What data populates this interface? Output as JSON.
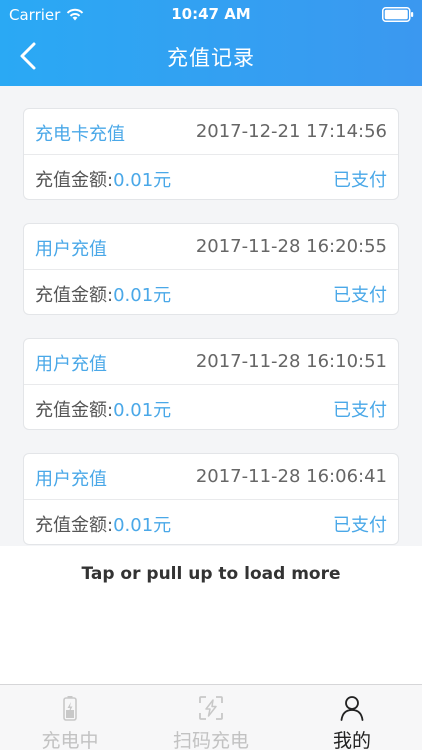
{
  "status_bar": {
    "carrier": "Carrier",
    "time": "10:47 AM"
  },
  "nav": {
    "title": "充值记录",
    "back_icon": "chevron-left-icon"
  },
  "records": [
    {
      "type": "充电卡充值",
      "time": "2017-12-21 17:14:56",
      "amount_label": "充值金额:",
      "amount": "0.01元",
      "status": "已支付"
    },
    {
      "type": "用户充值",
      "time": "2017-11-28 16:20:55",
      "amount_label": "充值金额:",
      "amount": "0.01元",
      "status": "已支付"
    },
    {
      "type": "用户充值",
      "time": "2017-11-28 16:10:51",
      "amount_label": "充值金额:",
      "amount": "0.01元",
      "status": "已支付"
    },
    {
      "type": "用户充值",
      "time": "2017-11-28 16:06:41",
      "amount_label": "充值金额:",
      "amount": "0.01元",
      "status": "已支付"
    }
  ],
  "load_more": "Tap or pull up to load more",
  "tab_bar": {
    "tabs": [
      {
        "label": "充电中",
        "icon": "battery-charging-icon",
        "active": false
      },
      {
        "label": "扫码充电",
        "icon": "scan-icon",
        "active": false
      },
      {
        "label": "我的",
        "icon": "user-icon",
        "active": true
      }
    ]
  },
  "colors": {
    "header": "#2aa9f4",
    "accent": "#4aa8e8",
    "tab_inactive": "#c2c2c2",
    "tab_active": "#222222"
  }
}
